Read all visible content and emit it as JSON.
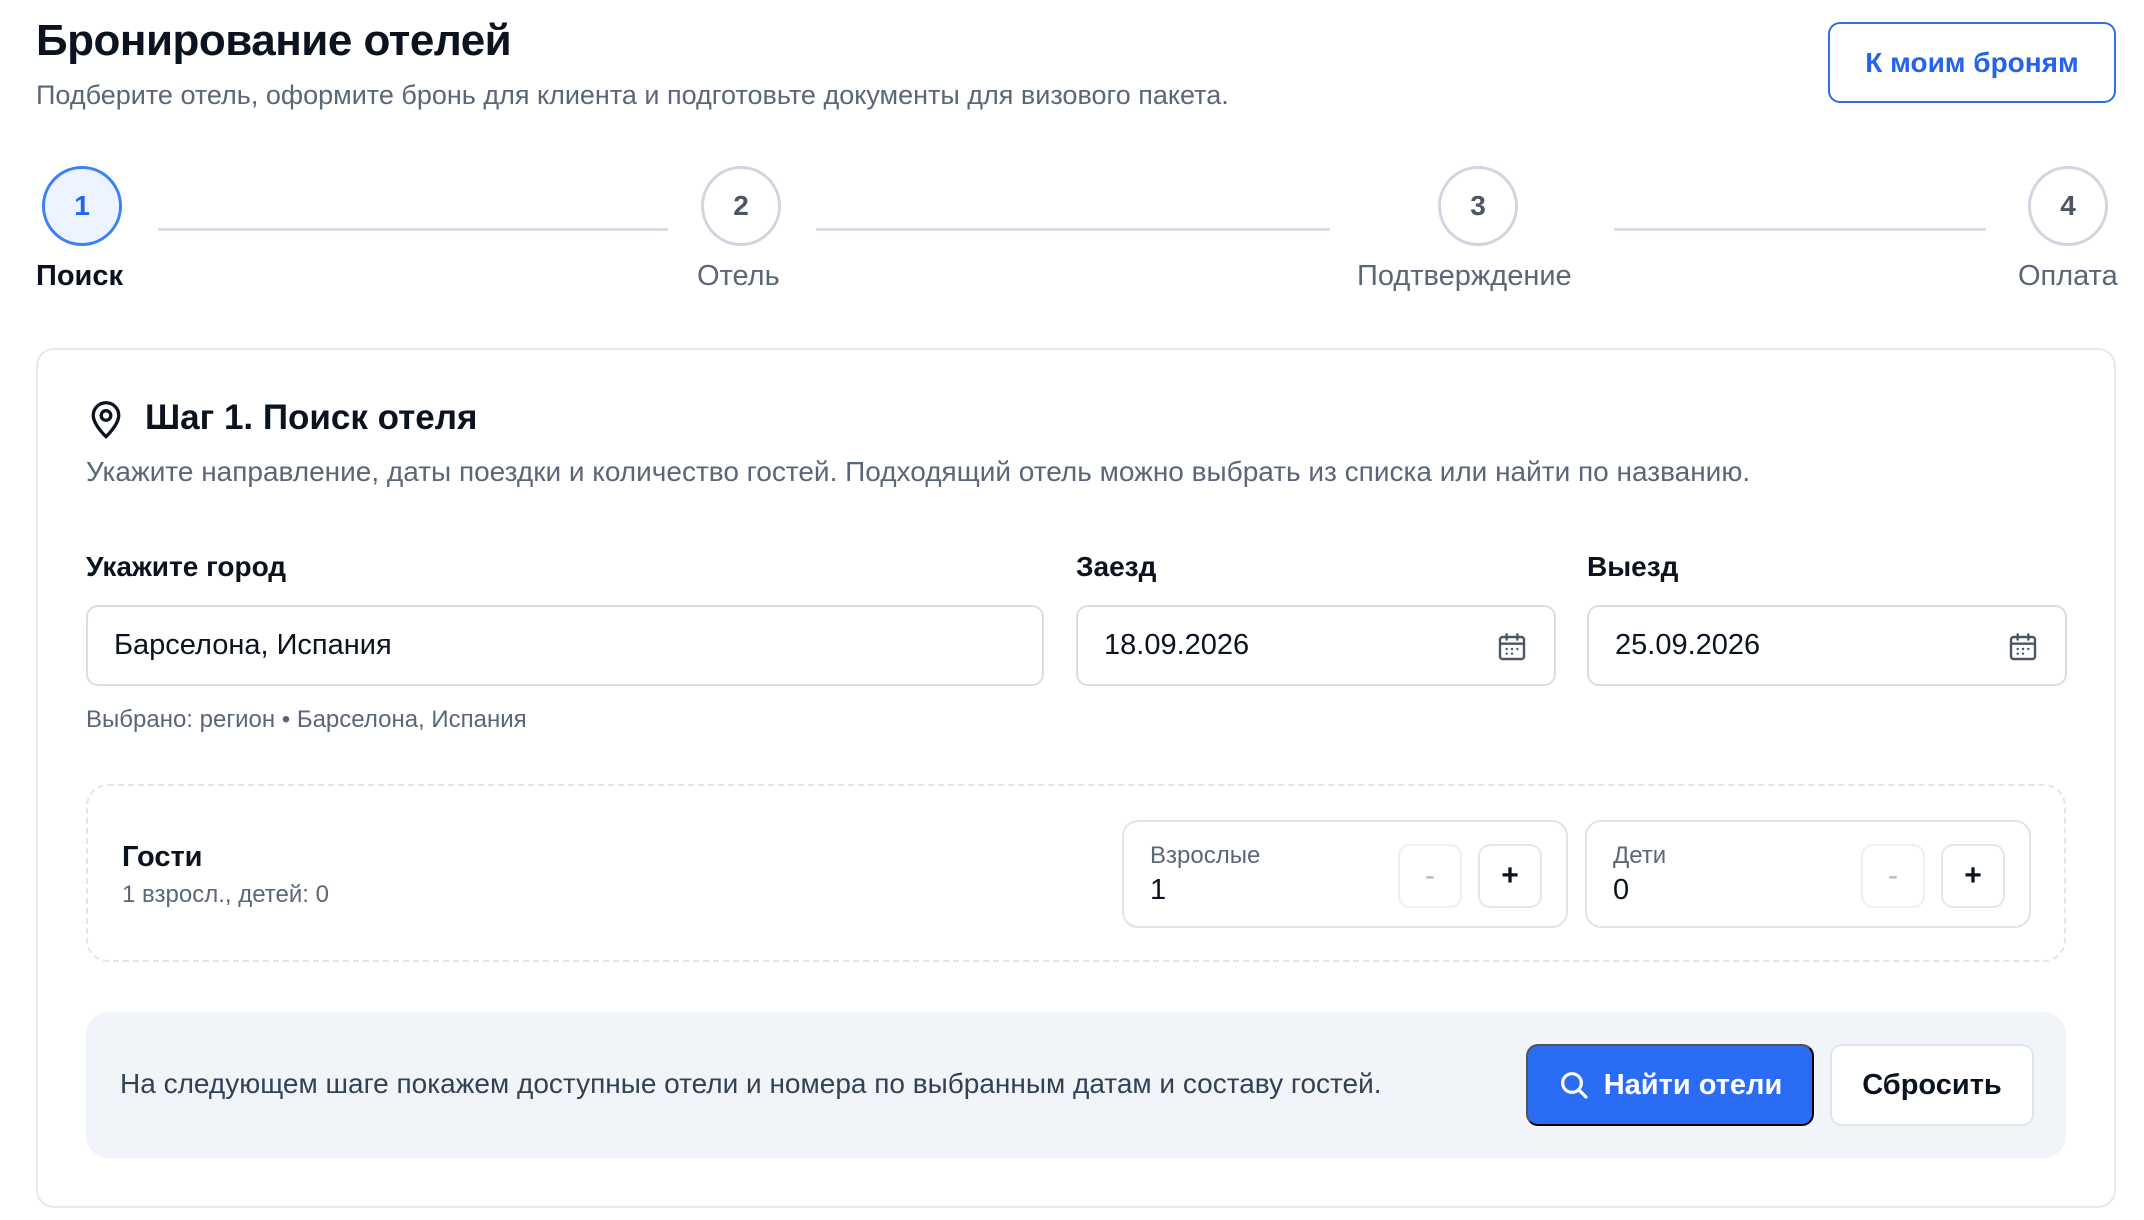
{
  "header": {
    "title": "Бронирование отелей",
    "subtitle": "Подберите отель, оформите бронь для клиента и подготовьте документы для визового пакета.",
    "my_bookings_label": "К моим броням"
  },
  "stepper": {
    "steps": [
      {
        "number": "1",
        "label": "Поиск",
        "active": true
      },
      {
        "number": "2",
        "label": "Отель",
        "active": false
      },
      {
        "number": "3",
        "label": "Подтверждение",
        "active": false
      },
      {
        "number": "4",
        "label": "Оплата",
        "active": false
      }
    ]
  },
  "card": {
    "icon": "map-pin-icon",
    "title": "Шаг 1. Поиск отеля",
    "description": "Укажите направление, даты поездки и количество гостей. Подходящий отель можно выбрать из списка или найти по названию.",
    "city": {
      "label": "Укажите город",
      "value": "Барселона, Испания",
      "hint": "Выбрано: регион • Барселона, Испания"
    },
    "checkin": {
      "label": "Заезд",
      "value": "18.09.2026",
      "icon": "calendar-icon"
    },
    "checkout": {
      "label": "Выезд",
      "value": "25.09.2026",
      "icon": "calendar-icon"
    },
    "guests": {
      "title": "Гости",
      "summary": "1 взросл., детей: 0",
      "adults": {
        "label": "Взрослые",
        "value": "1",
        "minus": "-",
        "plus": "+"
      },
      "children": {
        "label": "Дети",
        "value": "0",
        "minus": "-",
        "plus": "+"
      }
    },
    "actions": {
      "note": "На следующем шаге покажем доступные отели и номера по выбранным датам и составу гостей.",
      "find_label": "Найти отели",
      "find_icon": "search-icon",
      "reset_label": "Сбросить"
    }
  },
  "colors": {
    "accent": "#2a6df4",
    "active_step_bg": "#eef4ff",
    "muted_text": "#5b6678",
    "border": "#d9dee6"
  }
}
